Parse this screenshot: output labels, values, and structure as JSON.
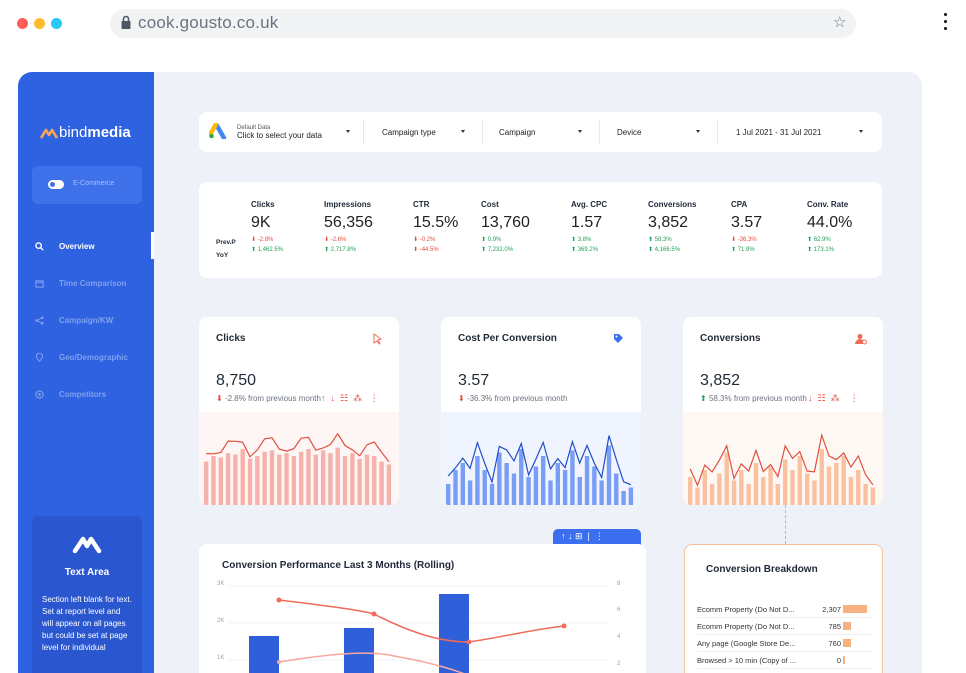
{
  "browser": {
    "url": "cook.gousto.co.uk",
    "traffic_light_colors": [
      "#ff5f57",
      "#febc2e",
      "#28c8f5"
    ]
  },
  "sidebar": {
    "brand_light": "bind",
    "brand_bold": "media",
    "toggle_label": "E-Commerce",
    "items": [
      {
        "label": "Overview",
        "icon": "search-icon",
        "active": true
      },
      {
        "label": "Time Comparison",
        "icon": "calendar-icon",
        "active": false
      },
      {
        "label": "Campaign/KW",
        "icon": "share-icon",
        "active": false
      },
      {
        "label": "Geo/Demographic",
        "icon": "location-icon",
        "active": false
      },
      {
        "label": "Competitors",
        "icon": "target-icon",
        "active": false
      }
    ],
    "text_area": {
      "title": "Text Area",
      "body": "Section left blank for text. Set at report level and will appear on all pages but could be set at page level for individual"
    }
  },
  "filters": {
    "data_source_small": "Default Data",
    "data_source": "Click to select your data",
    "campaign_type": "Campaign type",
    "campaign": "Campaign",
    "device": "Device",
    "date_range": "1 Jul 2021 - 31 Jul 2021"
  },
  "kpis": {
    "row_labels": [
      "Prev.P",
      "YoY"
    ],
    "columns": [
      {
        "label": "Clicks",
        "value": "9K",
        "prev": "-2.8%",
        "prev_dir": "down",
        "yoy": "1,462.5%",
        "yoy_dir": "up"
      },
      {
        "label": "Impressions",
        "value": "56,356",
        "prev": "-2.6%",
        "prev_dir": "down",
        "yoy": "2,717.8%",
        "yoy_dir": "up"
      },
      {
        "label": "CTR",
        "value": "15.5%",
        "prev": "-0.2%",
        "prev_dir": "down",
        "yoy": "-44.5%",
        "yoy_dir": "down"
      },
      {
        "label": "Cost",
        "value": "13,760",
        "prev": "0.9%",
        "prev_dir": "up",
        "yoy": "7,232.0%",
        "yoy_dir": "up"
      },
      {
        "label": "Avg. CPC",
        "value": "1.57",
        "prev": "3.8%",
        "prev_dir": "up",
        "yoy": "369.2%",
        "yoy_dir": "up"
      },
      {
        "label": "Conversions",
        "value": "3,852",
        "prev": "58.3%",
        "prev_dir": "up",
        "yoy": "4,166.5%",
        "yoy_dir": "up"
      },
      {
        "label": "CPA",
        "value": "3.57",
        "prev": "-36.3%",
        "prev_dir": "down",
        "yoy": "71.9%",
        "yoy_dir": "up"
      },
      {
        "label": "Conv. Rate",
        "value": "44.0%",
        "prev": "62.9%",
        "prev_dir": "up",
        "yoy": "173.1%",
        "yoy_dir": "up"
      }
    ]
  },
  "cards": [
    {
      "title": "Clicks",
      "value": "8,750",
      "change": "-2.8% from previous month",
      "dir": "down",
      "color": "#f08c84",
      "icon": "cursor-icon"
    },
    {
      "title": "Cost Per Conversion",
      "value": "3.57",
      "change": "-36.3% from previous month",
      "dir": "down",
      "color": "#3b6ff0",
      "icon": "tag-icon"
    },
    {
      "title": "Conversions",
      "value": "3,852",
      "change": "58.3% from previous month",
      "dir": "up",
      "color": "#f7a374",
      "icon": "user-icon"
    }
  ],
  "performance": {
    "title": "Conversion Performance Last 3 Months (Rolling)",
    "y_left": [
      "3K",
      "2K",
      "1K"
    ],
    "y_right": [
      "8",
      "6",
      "4",
      "2"
    ]
  },
  "breakdown": {
    "title": "Conversion Breakdown",
    "rows": [
      {
        "label": "Ecomm Property (Do Not D...",
        "value": "2,307",
        "share": 1.0
      },
      {
        "label": "Ecomm Property (Do Not D...",
        "value": "785",
        "share": 0.34
      },
      {
        "label": "Any page (Google Store De...",
        "value": "760",
        "share": 0.33
      },
      {
        "label": "Browsed > 10 min (Copy of ...",
        "value": "0",
        "share": 0.02
      }
    ]
  }
}
